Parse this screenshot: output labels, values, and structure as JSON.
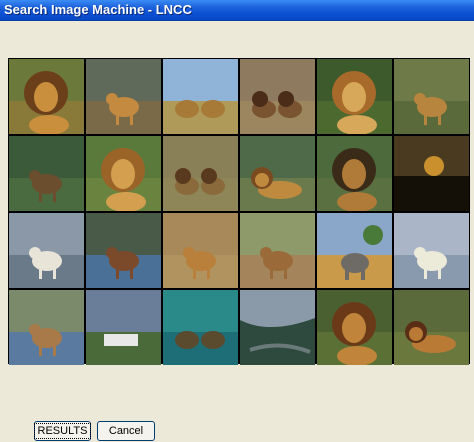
{
  "window": {
    "title": "Search Image Machine - LNCC"
  },
  "results_grid": {
    "rows": 4,
    "columns": 6,
    "items": [
      {
        "subject": "lion",
        "scene": "grass",
        "sky": "#6b7a3a",
        "ground": "#8a7a3a",
        "animal": "#c98f3c",
        "mane": "#6b3f1a"
      },
      {
        "subject": "lioness",
        "scene": "savanna",
        "sky": "#5f6a5a",
        "ground": "#7a6a48",
        "animal": "#c48a40",
        "mane": ""
      },
      {
        "subject": "lions-resting",
        "scene": "plain",
        "sky": "#8fb4d8",
        "ground": "#b09a5a",
        "animal": "#a87a38",
        "mane": ""
      },
      {
        "subject": "lions-pair",
        "scene": "grass",
        "sky": "#8e7a5e",
        "ground": "#9b8660",
        "animal": "#7a5430",
        "mane": "#4a2c18"
      },
      {
        "subject": "lion",
        "scene": "forest",
        "sky": "#3c5a2c",
        "ground": "#4c6a30",
        "animal": "#d8a85a",
        "mane": "#a86a2a"
      },
      {
        "subject": "lion-walking",
        "scene": "marsh",
        "sky": "#6e7a48",
        "ground": "#5a6a3a",
        "animal": "#b8853e",
        "mane": "#7a4a20"
      },
      {
        "subject": "bear",
        "scene": "grass",
        "sky": "#3a5a3a",
        "ground": "#4a6a40",
        "animal": "#6b4e2e",
        "mane": ""
      },
      {
        "subject": "lion",
        "scene": "grass",
        "sky": "#5a7a3c",
        "ground": "#6a8440",
        "animal": "#d4a050",
        "mane": "#9a6428"
      },
      {
        "subject": "lions-pair",
        "scene": "grass",
        "sky": "#8a8058",
        "ground": "#8e8658",
        "animal": "#8a6a3a",
        "mane": "#5a3a1e"
      },
      {
        "subject": "lion-lying",
        "scene": "grass",
        "sky": "#4e6a48",
        "ground": "#6a7a4c",
        "animal": "#c08a3e",
        "mane": "#7a4a20"
      },
      {
        "subject": "lion",
        "scene": "grass",
        "sky": "#4c6a3c",
        "ground": "#5a7040",
        "animal": "#b07a38",
        "mane": "#3a2a18"
      },
      {
        "subject": "sunset",
        "scene": "sky",
        "sky": "#4a3a20",
        "ground": "#1e1a12",
        "animal": "#e0a030",
        "mane": ""
      },
      {
        "subject": "polar-bear",
        "scene": "rocks",
        "sky": "#8a98a8",
        "ground": "#6a7a88",
        "animal": "#e8e4d8",
        "mane": ""
      },
      {
        "subject": "bear-water",
        "scene": "river",
        "sky": "#4a5a48",
        "ground": "#4a7098",
        "animal": "#7a4a2a",
        "mane": ""
      },
      {
        "subject": "lion-walking",
        "scene": "savanna",
        "sky": "#a88a5a",
        "ground": "#b0935e",
        "animal": "#b8803a",
        "mane": ""
      },
      {
        "subject": "lioness",
        "scene": "savanna",
        "sky": "#8e9a6a",
        "ground": "#a4845a",
        "animal": "#9a6a38",
        "mane": ""
      },
      {
        "subject": "elephant",
        "scene": "savanna",
        "sky": "#8aa6c8",
        "ground": "#c89a4a",
        "animal": "#6e6a66",
        "mane": ""
      },
      {
        "subject": "polar-bear",
        "scene": "snow",
        "sky": "#aab6c8",
        "ground": "#8a9aae",
        "animal": "#ecead8",
        "mane": ""
      },
      {
        "subject": "bear-water",
        "scene": "river",
        "sky": "#7a8a6a",
        "ground": "#5a7aa0",
        "animal": "#a87a4a",
        "mane": ""
      },
      {
        "subject": "building",
        "scene": "hills",
        "sky": "#6a7e9a",
        "ground": "#4a6a3a",
        "animal": "#e8e8e8",
        "mane": ""
      },
      {
        "subject": "bears-water",
        "scene": "water",
        "sky": "#2a8a8a",
        "ground": "#1e6e78",
        "animal": "#5a4a2e",
        "mane": ""
      },
      {
        "subject": "aerial",
        "scene": "valley",
        "sky": "#8a9aa8",
        "ground": "#3a5a4a",
        "animal": "#6a7a7a",
        "mane": ""
      },
      {
        "subject": "lion",
        "scene": "grass",
        "sky": "#4a6030",
        "ground": "#5a7034",
        "animal": "#c0843a",
        "mane": "#6a3a18"
      },
      {
        "subject": "lion-lying",
        "scene": "grass",
        "sky": "#5a6a3a",
        "ground": "#6a783e",
        "animal": "#b87a34",
        "mane": "#5a2e14"
      }
    ]
  },
  "buttons": {
    "results_label": "RESULTS",
    "cancel_label": "Cancel"
  }
}
